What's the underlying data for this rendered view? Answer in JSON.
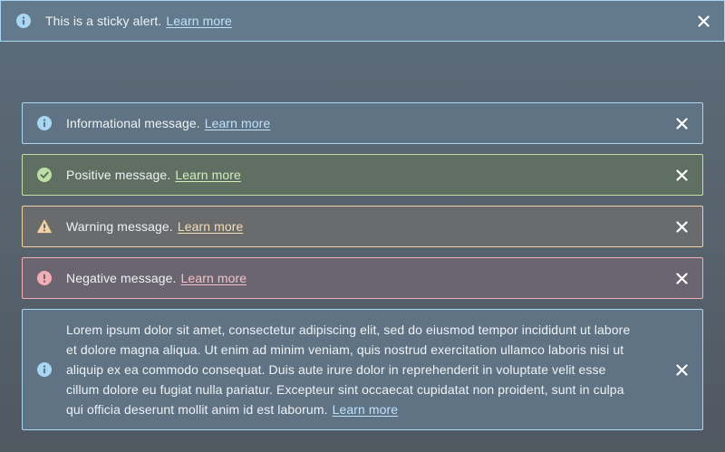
{
  "colors": {
    "info_accent": "#a9d6f2",
    "positive_accent": "#bfe0a5",
    "warning_accent": "#f0d2a3",
    "negative_accent": "#f2aeb4"
  },
  "sticky_alert": {
    "icon": "info-icon",
    "message": "This is a sticky alert.",
    "link": "Learn more",
    "close_icon": "close-icon"
  },
  "alerts": [
    {
      "type": "info",
      "icon": "info-icon",
      "message": "Informational message.",
      "link": "Learn more",
      "close_icon": "close-icon"
    },
    {
      "type": "positive",
      "icon": "check-circle-icon",
      "message": "Positive message.",
      "link": "Learn more",
      "close_icon": "close-icon"
    },
    {
      "type": "warning",
      "icon": "warning-triangle-icon",
      "message": "Warning message.",
      "link": "Learn more",
      "close_icon": "close-icon"
    },
    {
      "type": "negative",
      "icon": "exclamation-circle-icon",
      "message": "Negative message.",
      "link": "Learn more",
      "close_icon": "close-icon"
    },
    {
      "type": "info",
      "icon": "info-icon",
      "message": "Lorem ipsum dolor sit amet, consectetur adipiscing elit, sed do eiusmod tempor incididunt ut labore et dolore magna aliqua. Ut enim ad minim veniam, quis nostrud exercitation ullamco laboris nisi ut aliquip ex ea commodo consequat. Duis aute irure dolor in reprehenderit in voluptate velit esse cillum dolore eu fugiat nulla pariatur. Excepteur sint occaecat cupidatat non proident, sunt in culpa qui officia deserunt mollit anim id est laborum.",
      "link": "Learn more",
      "close_icon": "close-icon"
    }
  ]
}
